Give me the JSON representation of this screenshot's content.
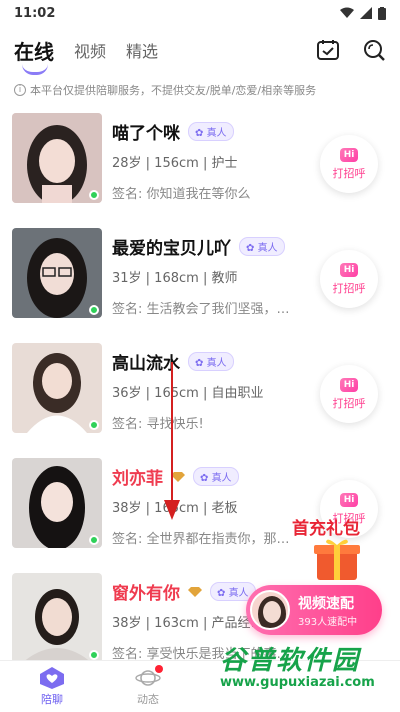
{
  "status_bar": {
    "time": "11:02"
  },
  "tabs": [
    {
      "label": "在线",
      "active": true
    },
    {
      "label": "视频",
      "active": false
    },
    {
      "label": "精选",
      "active": false
    }
  ],
  "notice": "本平台仅提供陪聊服务，不提供交友/脱单/恋爱/相亲等服务",
  "users": [
    {
      "name": "喵了个咪",
      "vip": false,
      "badge": "真人",
      "meta": "28岁 | 156cm | 护士",
      "signature": "签名: 你知道我在等你么",
      "online": true
    },
    {
      "name": "最爱的宝贝儿吖",
      "vip": false,
      "badge": "真人",
      "meta": "31岁 | 168cm | 教师",
      "signature": "签名: 生活教会了我们坚强，…",
      "online": true
    },
    {
      "name": "高山流水",
      "vip": false,
      "badge": "真人",
      "meta": "36岁 | 165cm | 自由职业",
      "signature": "签名: 寻找快乐!",
      "online": true
    },
    {
      "name": "刘亦菲",
      "vip": true,
      "badge": "真人",
      "meta": "38岁 | 165cm | 老板",
      "signature": "签名: 全世界都在指责你，那…",
      "online": true
    },
    {
      "name": "窗外有你",
      "vip": true,
      "badge": "真人",
      "meta": "38岁 | 163cm | 产品经…",
      "signature": "签名: 享受快乐是我当下的事…",
      "online": true
    }
  ],
  "greet_button": {
    "hi": "Hi",
    "label": "打招呼"
  },
  "promo": {
    "title": "首充礼包"
  },
  "speed_match": {
    "title": "视频速配",
    "subtitle": "393人速配中"
  },
  "bottom_nav": [
    {
      "label": "陪聊",
      "active": true
    },
    {
      "label": "动态",
      "active": false,
      "has_dot": true
    }
  ],
  "watermark": {
    "title": "谷普软件园",
    "url": "www.gupuxiazai.com"
  }
}
